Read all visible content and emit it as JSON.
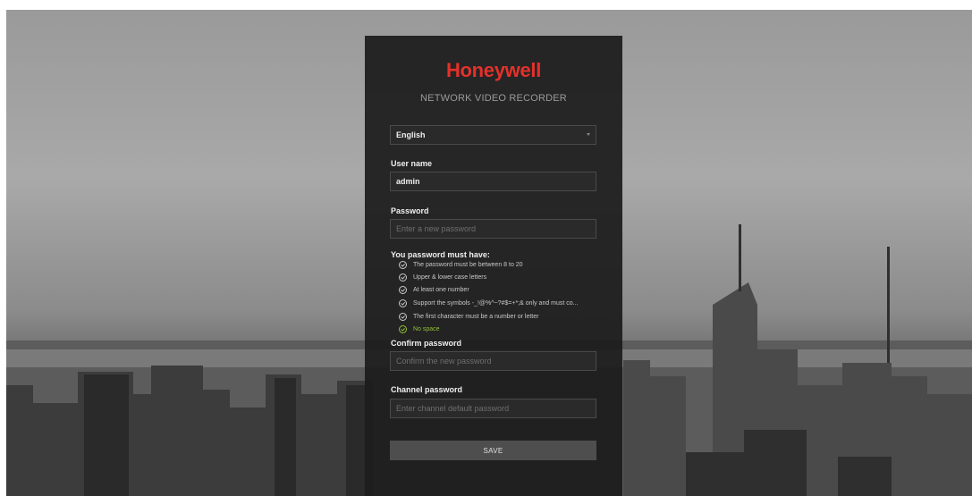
{
  "brand": {
    "logo_text": "Honeywell",
    "subtitle": "NETWORK VIDEO RECORDER",
    "logo_color": "#e4312b"
  },
  "language": {
    "selected": "English"
  },
  "username": {
    "label": "User name",
    "value": "admin"
  },
  "password": {
    "label": "Password",
    "placeholder": "Enter a new password"
  },
  "requirements": {
    "title": "You password must have:",
    "items": [
      {
        "text": "The password must be between 8 to 20",
        "met": false
      },
      {
        "text": "Upper & lower case letters",
        "met": false
      },
      {
        "text": "At least one number",
        "met": false
      },
      {
        "text": "Support the symbols -_!@%^~?#$=+*;& only and must co...",
        "met": false
      },
      {
        "text": "The first character must be a number or letter",
        "met": false
      },
      {
        "text": "No space",
        "met": true
      }
    ],
    "met_color": "#8fbf3a"
  },
  "confirm_password": {
    "label": "Confirm password",
    "placeholder": "Confirm the new password"
  },
  "channel_password": {
    "label": "Channel password",
    "placeholder": "Enter channel default password"
  },
  "save_label": "SAVE"
}
